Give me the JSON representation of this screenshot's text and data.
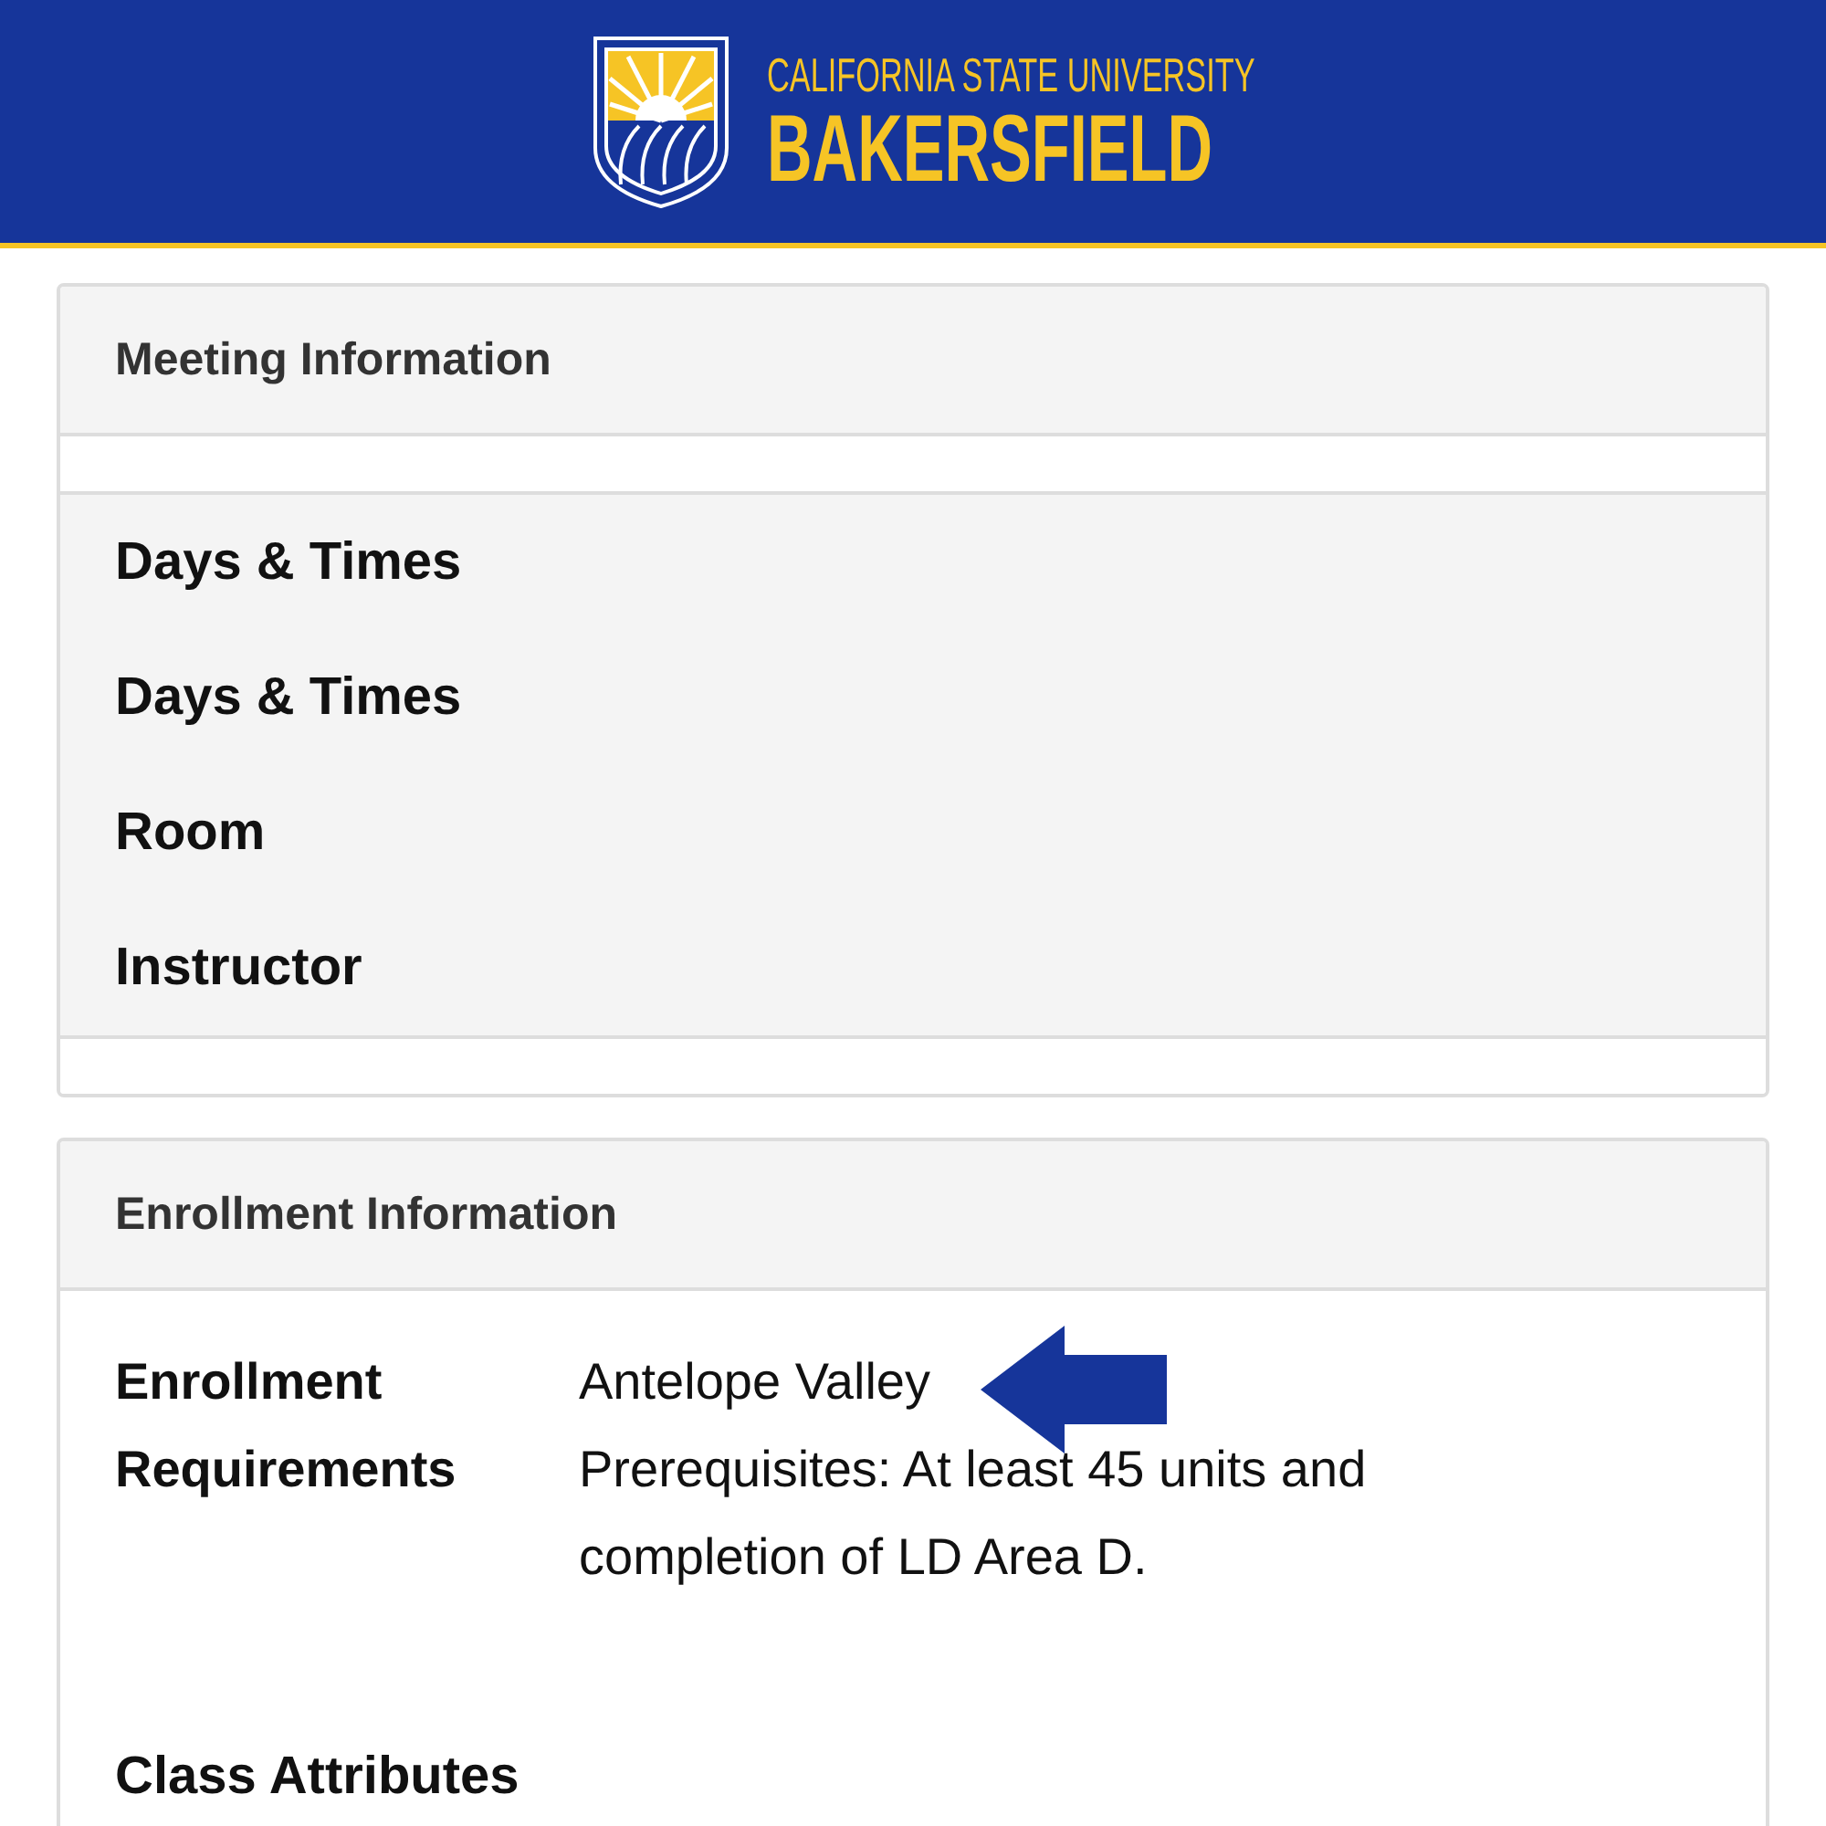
{
  "header": {
    "logo_top": "CALIFORNIA STATE UNIVERSITY",
    "logo_bottom": "BAKERSFIELD"
  },
  "meeting": {
    "title": "Meeting Information",
    "rows": [
      "Days & Times",
      "Days & Times",
      "Room",
      "Instructor"
    ]
  },
  "enrollment": {
    "title": "Enrollment Information",
    "fields": [
      {
        "label": "Enrollment Requirements",
        "values": [
          "Antelope Valley",
          "Prerequisites: At least 45 units and completion of LD Area D."
        ]
      }
    ],
    "next_heading": "Class Attributes"
  }
}
